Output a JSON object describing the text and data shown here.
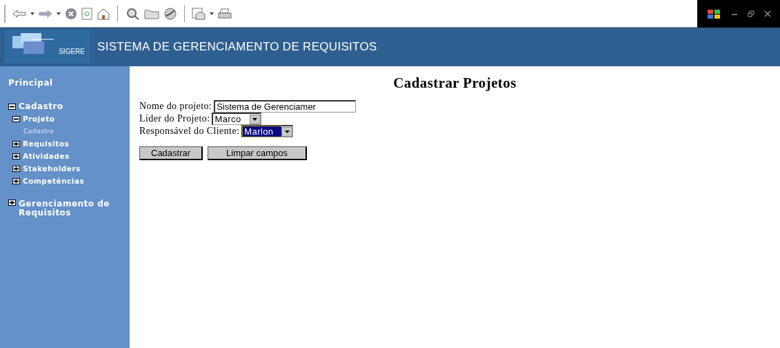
{
  "header": {
    "logo": "SIGERE",
    "title": "SISTEMA DE GERENCIAMENTO DE REQUISITOS"
  },
  "sidebar": {
    "heading": "Principal",
    "tree": [
      {
        "label": "Cadastro",
        "expanded": true,
        "children": [
          {
            "label": "Projeto",
            "expanded": true,
            "children": [
              {
                "label": "Cadastro"
              }
            ]
          },
          {
            "label": "Requisitos",
            "expanded": false
          },
          {
            "label": "Atividades",
            "expanded": false
          },
          {
            "label": "Stakeholders",
            "expanded": false
          },
          {
            "label": "Competências",
            "expanded": false
          }
        ]
      },
      {
        "label": "Gerenciamento de Requisitos",
        "expanded": false
      }
    ]
  },
  "page": {
    "title": "Cadastrar Projetos",
    "fields": [
      {
        "kind": "text",
        "label": "Nome do projeto:",
        "value": "Sistema de Gerenciamer"
      },
      {
        "kind": "select",
        "label": "Lider do Projeto:",
        "value": "Marco",
        "highlighted": false
      },
      {
        "kind": "select",
        "label": "Responsável do Cliente:",
        "value": "Marlon",
        "highlighted": true
      }
    ],
    "buttons": [
      "Cadastrar",
      "Limpar campos"
    ]
  }
}
